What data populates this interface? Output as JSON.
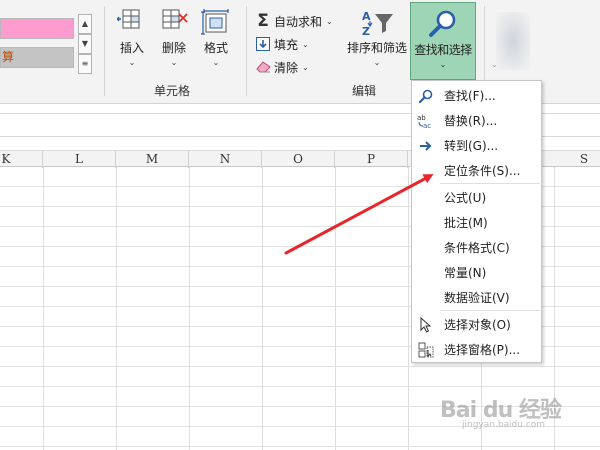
{
  "ribbon": {
    "styles": {
      "pink_cell_text": "",
      "gray_cell_text": "算"
    },
    "cells_group": {
      "label": "单元格",
      "insert_label": "插入",
      "delete_label": "删除",
      "format_label": "格式"
    },
    "editing_group": {
      "label": "编辑",
      "autosum_label": "自动求和",
      "fill_label": "填充",
      "clear_label": "清除",
      "sort_filter_label": "排序和筛选",
      "find_select_label": "查找和选择"
    }
  },
  "sheet": {
    "columns": [
      "K",
      "L",
      "M",
      "N",
      "O",
      "P",
      "",
      "S"
    ]
  },
  "menu": {
    "items": [
      {
        "label": "查找(F)...",
        "icon": "search-icon"
      },
      {
        "label": "替换(R)...",
        "icon": "replace-icon"
      },
      {
        "label": "转到(G)...",
        "icon": "goto-arrow-icon"
      },
      {
        "label": "定位条件(S)...",
        "icon": ""
      },
      {
        "label": "公式(U)",
        "icon": ""
      },
      {
        "label": "批注(M)",
        "icon": ""
      },
      {
        "label": "条件格式(C)",
        "icon": ""
      },
      {
        "label": "常量(N)",
        "icon": ""
      },
      {
        "label": "数据验证(V)",
        "icon": ""
      },
      {
        "label": "选择对象(O)",
        "icon": "cursor-arrow-icon"
      },
      {
        "label": "选择窗格(P)...",
        "icon": "selection-pane-icon"
      }
    ]
  },
  "annotation": {
    "arrow_color": "#e8262a"
  },
  "watermark": {
    "text": "Bai du 经验",
    "url": "jingyan.baidu.com"
  },
  "colors": {
    "find_select_highlight": "#9fd5b7",
    "accent_blue": "#2b5fa8"
  }
}
